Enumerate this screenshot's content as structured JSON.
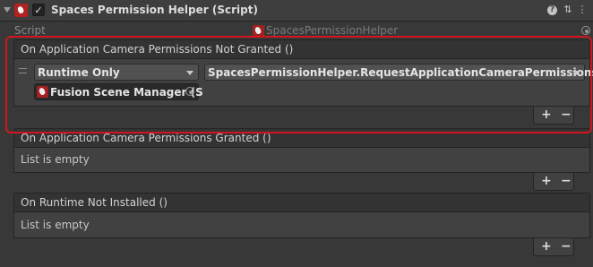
{
  "component": {
    "title": "Spaces Permission Helper (Script)",
    "enabled": true
  },
  "script_field": {
    "label": "Script",
    "value": "SpacesPermissionHelper"
  },
  "events": [
    {
      "header": "On Application Camera Permissions Not Granted ()",
      "runtime_option": "Runtime Only",
      "function": "SpacesPermissionHelper.RequestApplicationCameraPermissions",
      "target_object": "Fusion Scene Manager (S"
    },
    {
      "header": "On Application Camera Permissions Granted ()",
      "empty_text": "List is empty"
    },
    {
      "header": "On Runtime Not Installed ()",
      "empty_text": "List is empty"
    }
  ],
  "buttons": {
    "plus": "+",
    "minus": "−"
  },
  "icons": {
    "help": "?",
    "presets": "⇅",
    "menu": "⋮",
    "check": "✓"
  },
  "colors": {
    "highlight": "#d0161c",
    "script_icon": "#b32020"
  }
}
